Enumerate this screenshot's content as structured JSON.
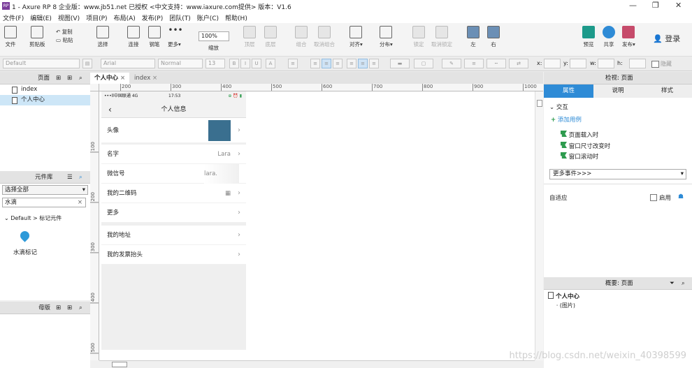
{
  "window": {
    "title": "1 - Axure RP 8 企业版：www.jb51.net 已授权        <中文支持：www.iaxure.com提供> 版本：V1.6"
  },
  "menu": [
    "文件(F)",
    "编辑(E)",
    "视图(V)",
    "项目(P)",
    "布局(A)",
    "发布(P)",
    "团队(T)",
    "账户(C)",
    "帮助(H)"
  ],
  "toolbar": {
    "file": "文件",
    "clipboard": "剪贴板",
    "copy": "复制",
    "paste": "粘贴",
    "select": "选择",
    "connect": "连接",
    "pen": "钢笔",
    "more": "更多▾",
    "zoom": "100%",
    "zoom_label": "缩放",
    "top": "顶层",
    "bottom": "底层",
    "group": "组合",
    "ungroup": "取消组合",
    "align": "对齐▾",
    "distribute": "分布▾",
    "lock": "锁定",
    "unlock": "取消锁定",
    "left": "左",
    "right": "右",
    "preview": "预览",
    "share": "共享",
    "publish": "发布▾",
    "login": "登录"
  },
  "format": {
    "style": "Default",
    "font": "Arial",
    "weight": "Normal",
    "size": "13",
    "x_label": "x:",
    "y_label": "y:",
    "w_label": "w:",
    "h_label": "h:",
    "hide": "隐藏"
  },
  "pages_panel": {
    "title": "页面",
    "items": [
      "index",
      "个人中心"
    ]
  },
  "library_panel": {
    "title": "元件库",
    "select_all": "选择全部",
    "search": "水滴",
    "group": "Default > 标记元件",
    "widget": "水滴标记"
  },
  "masters_panel": {
    "title": "母版"
  },
  "canvas_tabs": [
    "个人中心",
    "index"
  ],
  "ruler_h": [
    "200",
    "300",
    "400",
    "500",
    "600",
    "700",
    "800",
    "900",
    "1000"
  ],
  "ruler_v": [
    "100",
    "200",
    "300",
    "400",
    "500"
  ],
  "phone": {
    "status_carrier": "•••ll中国联通 4G",
    "status_time": "17:53",
    "status_icons": "⊕ ⏰ ▮",
    "nav_title": "个人信息",
    "rows": [
      {
        "label": "头像",
        "value": ""
      },
      {
        "label": "名字",
        "value": "Lara"
      },
      {
        "label": "微信号",
        "value": "lara."
      },
      {
        "label": "我的二维码",
        "value": ""
      },
      {
        "label": "更多",
        "value": ""
      },
      {
        "label": "我的地址",
        "value": ""
      },
      {
        "label": "我的发票抬头",
        "value": ""
      }
    ]
  },
  "inspector": {
    "title": "检视: 页面",
    "tabs": [
      "属性",
      "说明",
      "样式"
    ],
    "section": "交互",
    "add_case": "添加用例",
    "events": [
      "页面载入时",
      "窗口尺寸改变时",
      "窗口滚动时"
    ],
    "more_events": "更多事件>>>",
    "adaptive": "自适应",
    "enable": "启用"
  },
  "outline": {
    "title": "概要: 页面",
    "root": "个人中心",
    "child": "(图片)"
  },
  "watermark": "https://blog.csdn.net/weixin_40398599"
}
